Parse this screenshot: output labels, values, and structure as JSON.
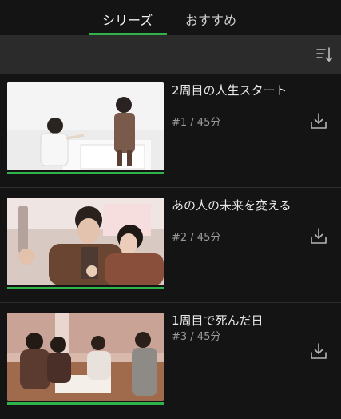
{
  "tabs": [
    {
      "label": "シリーズ",
      "active": true
    },
    {
      "label": "おすすめ",
      "active": false
    }
  ],
  "toolbar": {
    "sort_icon": "sort-descending-icon"
  },
  "episodes": [
    {
      "title": "2周目の人生スタート",
      "meta": "#1 / 45分",
      "progress": 1.0
    },
    {
      "title": "あの人の未来を変える",
      "meta": "#2 / 45分",
      "progress": 1.0
    },
    {
      "title": "1周目で死んだ日",
      "meta": "#3 / 45分",
      "progress": 1.0
    }
  ],
  "colors": {
    "accent": "#2fb34a",
    "background": "#141414",
    "toolbar": "#2b2b2b"
  }
}
